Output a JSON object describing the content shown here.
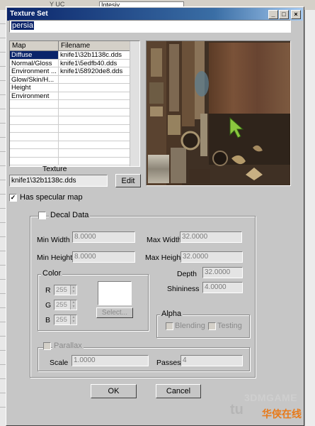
{
  "background": {
    "top_tab_fragment": "Y   UC",
    "field_fragment": "Intesiv"
  },
  "dialog": {
    "title": "Texture Set",
    "window_buttons": {
      "minimize": "_",
      "maximize": "□",
      "close": "×"
    },
    "name_input_value": "persia",
    "map_table": {
      "columns": [
        "Map",
        "Filename"
      ],
      "rows": [
        {
          "map": "Diffuse",
          "filename": "knife1\\32b1138c.dds",
          "selected": true
        },
        {
          "map": "Normal/Gloss",
          "filename": "knife1\\5edfb40.dds"
        },
        {
          "map": "Environment ...",
          "filename": "knife1\\58920de8.dds"
        },
        {
          "map": "Glow/Skin/H...",
          "filename": ""
        },
        {
          "map": "Height",
          "filename": ""
        },
        {
          "map": "Environment",
          "filename": ""
        }
      ]
    },
    "texture_label": "Texture",
    "texture_field_value": "knife1\\32b1138c.dds",
    "edit_button": "Edit",
    "has_specular_map": {
      "label": "Has specular map",
      "checked": true
    },
    "decal": {
      "label": "Decal Data",
      "checked": false,
      "min_width": {
        "label": "Min Width",
        "value": "8.0000"
      },
      "max_width": {
        "label": "Max Width",
        "value": "32.0000"
      },
      "min_height": {
        "label": "Min Height",
        "value": "8.0000"
      },
      "max_height": {
        "label": "Max Height",
        "value": "32.0000"
      },
      "depth": {
        "label": "Depth",
        "value": "32.0000"
      },
      "shininess": {
        "label": "Shininess",
        "value": "4.0000"
      },
      "color": {
        "label": "Color",
        "r": {
          "label": "R",
          "value": "255"
        },
        "g": {
          "label": "G",
          "value": "255"
        },
        "b": {
          "label": "B",
          "value": "255"
        },
        "swatch": "#ffffff",
        "select_button": "Select..."
      },
      "alpha": {
        "label": "Alpha",
        "blending": {
          "label": "Blending",
          "checked": false
        },
        "testing": {
          "label": "Testing",
          "checked": false
        }
      },
      "parallax": {
        "label": "Parallax",
        "checked": false,
        "scale": {
          "label": "Scale",
          "value": "1.0000"
        },
        "passes": {
          "label": "Passes",
          "value": "4"
        }
      }
    },
    "ok_button": "OK",
    "cancel_button": "Cancel"
  },
  "watermark": {
    "line1": "3DMGAME",
    "line2": "tu",
    "line3": "华侠在线"
  },
  "colors": {
    "title_start": "#0a246a",
    "title_end": "#a6caf0",
    "dialog_face": "#c6c6c6",
    "selection": "#0a246a",
    "arrow_cursor": "#8cc63f"
  },
  "icons": [
    "minimize-icon",
    "maximize-icon",
    "close-icon",
    "check-icon",
    "spin-up-icon",
    "spin-down-icon",
    "arrow-cursor-icon"
  ]
}
